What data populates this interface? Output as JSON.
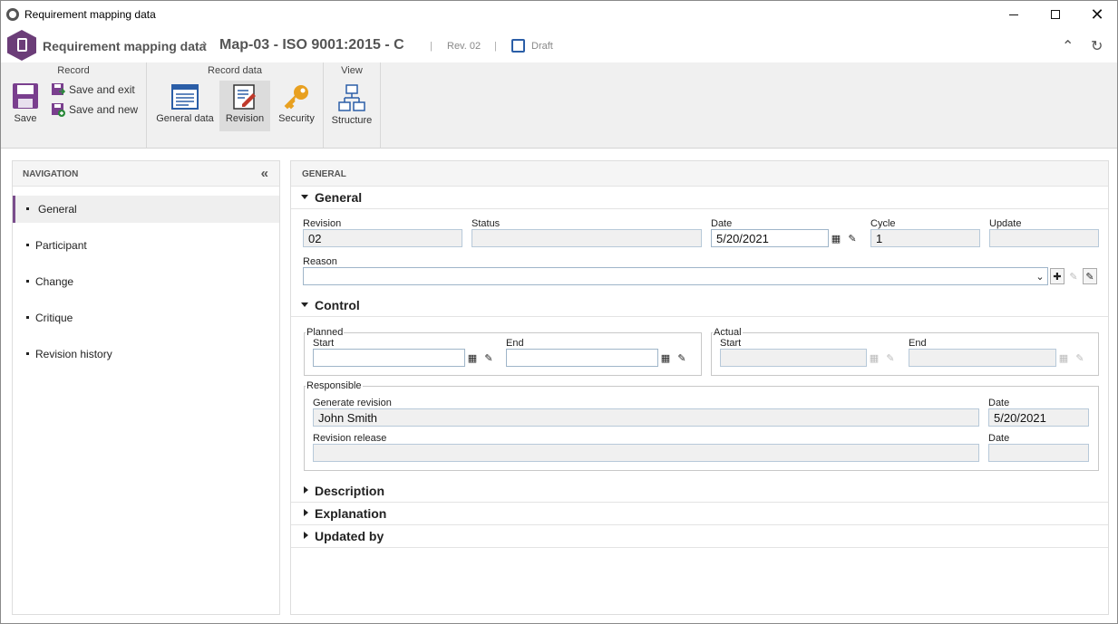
{
  "window": {
    "title": "Requirement mapping data",
    "minimize": "—",
    "maximize": "☐",
    "close": "✕"
  },
  "header": {
    "app_name": "Requirement mapping data",
    "separator": "›",
    "record_title": "Map-03 - ISO 9001:2015 - C",
    "revision": "Rev. 02",
    "pipe": "|",
    "status": "Draft",
    "collapse_icon": "⌃",
    "refresh_icon": "↻"
  },
  "ribbon": {
    "groups": {
      "record": "Record",
      "record_data": "Record data",
      "view": "View"
    },
    "save": "Save",
    "save_and_exit": "Save and exit",
    "save_and_new": "Save and new",
    "general_data": "General data",
    "revision": "Revision",
    "security": "Security",
    "structure": "Structure"
  },
  "navigation": {
    "title": "NAVIGATION",
    "collapse_icon": "«",
    "items": [
      {
        "label": "General",
        "active": true
      },
      {
        "label": "Participant"
      },
      {
        "label": "Change"
      },
      {
        "label": "Critique"
      },
      {
        "label": "Revision history"
      }
    ]
  },
  "main": {
    "title": "GENERAL",
    "sections": {
      "general": "General",
      "control": "Control",
      "description": "Description",
      "explanation": "Explanation",
      "updated_by": "Updated by"
    },
    "general": {
      "revision_label": "Revision",
      "revision_value": "02",
      "status_label": "Status",
      "status_value": "",
      "date_label": "Date",
      "date_value": "5/20/2021",
      "cycle_label": "Cycle",
      "cycle_value": "1",
      "update_label": "Update",
      "update_value": "",
      "reason_label": "Reason",
      "reason_value": ""
    },
    "control": {
      "planned_label": "Planned",
      "actual_label": "Actual",
      "start_label": "Start",
      "end_label": "End",
      "responsible_label": "Responsible",
      "generate_revision_label": "Generate revision",
      "generate_revision_value": "John Smith",
      "generate_date_label": "Date",
      "generate_date_value": "5/20/2021",
      "revision_release_label": "Revision release",
      "revision_release_value": "",
      "release_date_label": "Date",
      "release_date_value": ""
    }
  },
  "colors": {
    "accent": "#7a4d8c",
    "app_icon": "#6b3d78",
    "link_blue": "#2b5ea7"
  }
}
